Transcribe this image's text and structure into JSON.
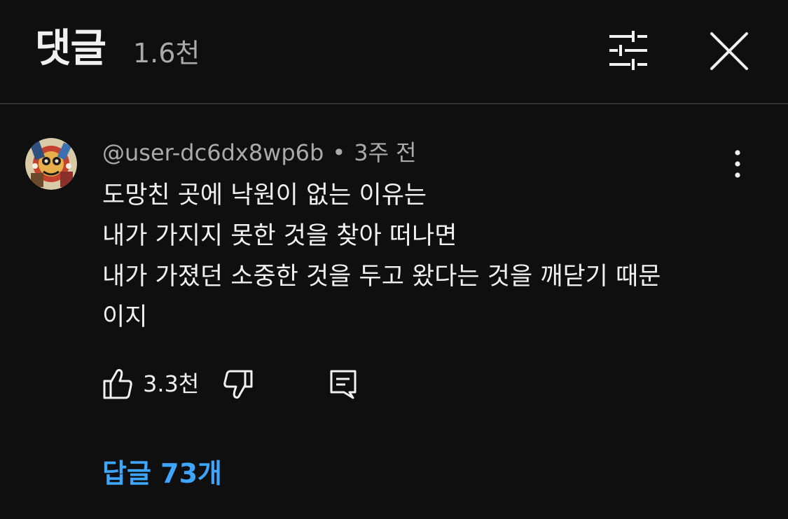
{
  "header": {
    "title": "댓글",
    "count": "1.6천",
    "filter_icon": "sliders-icon",
    "close_icon": "close-icon"
  },
  "comment": {
    "author": "@user-dc6dx8wp6b",
    "separator": "•",
    "time": "3주 전",
    "lines": [
      "도망친 곳에 낙원이 없는 이유는",
      "내가 가지지 못한 것을 찾아 떠나면",
      "내가 가졌던 소중한 것을 두고 왔다는 것을 깨닫기 때문",
      "이지"
    ],
    "likes": "3.3천",
    "replies_label": "답글 73개",
    "icons": {
      "more": "more-vertical-icon",
      "like": "thumbs-up-icon",
      "dislike": "thumbs-down-icon",
      "reply": "reply-comment-icon"
    }
  },
  "colors": {
    "background": "#0f0f0f",
    "text_primary": "#f1f1f1",
    "text_secondary": "#aaaaaa",
    "link": "#3ea6ff",
    "divider": "#303030"
  }
}
